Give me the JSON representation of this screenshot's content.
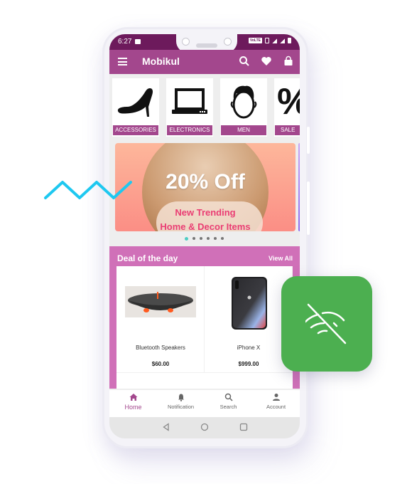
{
  "status_bar": {
    "time": "6:27",
    "network_badge": "VoLTE"
  },
  "app_bar": {
    "title": "Mobikul",
    "icons": [
      "menu-icon",
      "search-icon",
      "heart-icon",
      "cart-bag-icon"
    ]
  },
  "categories": [
    {
      "label": "ACCESSORIES",
      "icon": "high-heel-icon"
    },
    {
      "label": "ELECTRONICS",
      "icon": "laptop-icon"
    },
    {
      "label": "MEN",
      "icon": "man-face-icon"
    },
    {
      "label": "SALE",
      "icon": "percent-icon"
    }
  ],
  "banner": {
    "headline": "20% Off",
    "line1": "New Trending",
    "line2": "Home & Decor Items",
    "slide_count": 6,
    "active_slide": 1
  },
  "deal": {
    "title": "Deal of the day",
    "view_all": "View All",
    "products": [
      {
        "name": "Bluetooth Speakers",
        "price": "$60.00"
      },
      {
        "name": "iPhone X",
        "price": "$999.00"
      }
    ]
  },
  "bottom_nav": [
    {
      "label": "Home",
      "icon": "home-icon",
      "active": true
    },
    {
      "label": "Notification",
      "icon": "bell-icon",
      "active": false
    },
    {
      "label": "Search",
      "icon": "search-icon",
      "active": false
    },
    {
      "label": "Account",
      "icon": "person-icon",
      "active": false
    }
  ],
  "colors": {
    "primary": "#a3478d",
    "status_bar": "#6d1a5c",
    "deal_bg": "#d070b8",
    "accent_dot": "#4ecdc4",
    "offline_tile": "#4caf50",
    "zigzag": "#1ec8f0"
  },
  "decorations": {
    "offline_tile_icon": "wifi-off-icon",
    "zigzag": "zigzag-line"
  }
}
